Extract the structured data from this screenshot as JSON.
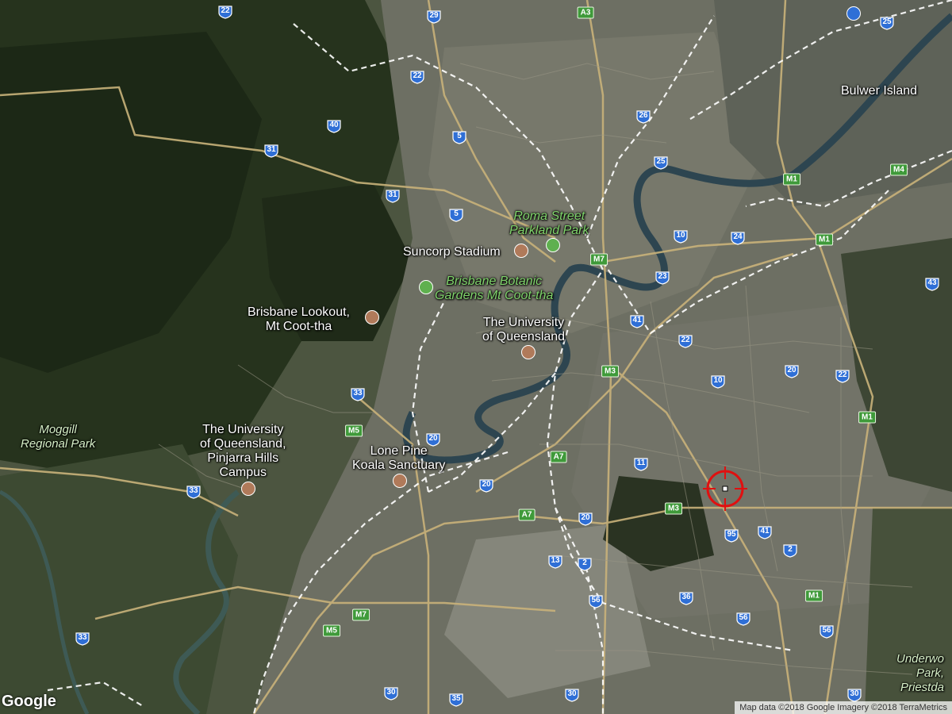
{
  "map": {
    "labels": {
      "bulwer_island": "Bulwer Island",
      "roma_street": "Roma Street\nParkland Park",
      "suncorp": "Suncorp Stadium",
      "botanic": "Brisbane Botanic\nGardens Mt Coot-tha",
      "lookout": "Brisbane Lookout,\nMt Coot-tha",
      "uq": "The University\nof Queensland",
      "moggill": "Moggill\nRegional Park",
      "uq_pinjarra": "The University\nof Queensland,\nPinjarra Hills\nCampus",
      "lone_pine": "Lone Pine\nKoala Sanctuary",
      "underwood": "Underwo\nPark,\nPriestda"
    },
    "route_shields": [
      "22",
      "29",
      "25",
      "22",
      "26",
      "5",
      "40",
      "31",
      "31",
      "25",
      "5",
      "10",
      "24",
      "23",
      "41",
      "22",
      "43",
      "20",
      "22",
      "10",
      "33",
      "20",
      "33",
      "20",
      "11",
      "20",
      "13",
      "2",
      "95",
      "41",
      "2",
      "56",
      "36",
      "56",
      "56",
      "33",
      "30",
      "35",
      "30",
      "30"
    ],
    "motorways": [
      "A3",
      "M1",
      "M4",
      "M1",
      "M7",
      "M3",
      "M5",
      "A7",
      "M3",
      "A7",
      "M7",
      "M5",
      "M1",
      "M1"
    ]
  },
  "footer": {
    "logo": "Google",
    "attribution": "Map data ©2018 Google  Imagery ©2018 TerraMetrics"
  },
  "colors": {
    "shield_blue": "#2f6fd6",
    "motorway_green": "#3f9a3a",
    "crosshair_red": "#e01010"
  }
}
